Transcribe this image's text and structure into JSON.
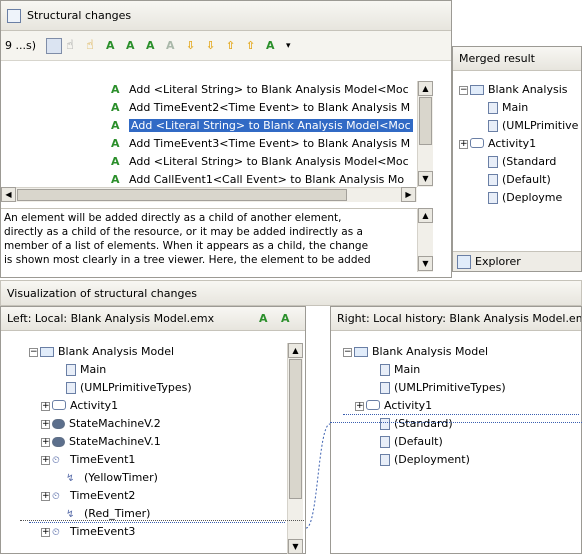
{
  "structural": {
    "title": "Structural changes",
    "dropdown_label": "9 ...s)",
    "changes": [
      {
        "label": "Add <Literal String> to Blank Analysis Model<Moc",
        "selected": false
      },
      {
        "label": "Add TimeEvent2<Time Event> to Blank Analysis M",
        "selected": false
      },
      {
        "label": "Add <Literal String> to Blank Analysis Model<Moc",
        "selected": true
      },
      {
        "label": "Add TimeEvent3<Time Event> to Blank Analysis M",
        "selected": false
      },
      {
        "label": "Add <Literal String> to Blank Analysis Model<Moc",
        "selected": false
      },
      {
        "label": "Add CallEvent1<Call Event> to Blank Analysis Mo",
        "selected": false
      }
    ],
    "description_lines": [
      "An element will be added directly as a child of another element,",
      "directly as a child of the resource, or it may be added indirectly as a",
      "member of a list of elements. When it appears as a child, the change",
      "is shown most clearly in a tree viewer. Here, the element to be added"
    ]
  },
  "merged": {
    "title": "Merged result",
    "tree": [
      "Blank Analysis",
      "Main",
      "(UMLPrimitive",
      "Activity1",
      "(Standard",
      "(Default)",
      "(Deployme"
    ],
    "tab_explorer": "Explorer"
  },
  "visualization": {
    "title": "Visualization of structural changes"
  },
  "left": {
    "title": "Left: Local: Blank Analysis Model.emx",
    "tree": [
      "Blank Analysis Model",
      "Main",
      "(UMLPrimitiveTypes)",
      "Activity1",
      "StateMachineV.2",
      "StateMachineV.1",
      "TimeEvent1",
      "(YellowTimer)",
      "TimeEvent2",
      "(Red_Timer)",
      "TimeEvent3"
    ]
  },
  "right": {
    "title": "Right: Local history: Blank Analysis Model.em",
    "tree": [
      "Blank Analysis Model",
      "Main",
      "(UMLPrimitiveTypes)",
      "Activity1",
      "(Standard)",
      "(Default)",
      "(Deployment)"
    ]
  }
}
